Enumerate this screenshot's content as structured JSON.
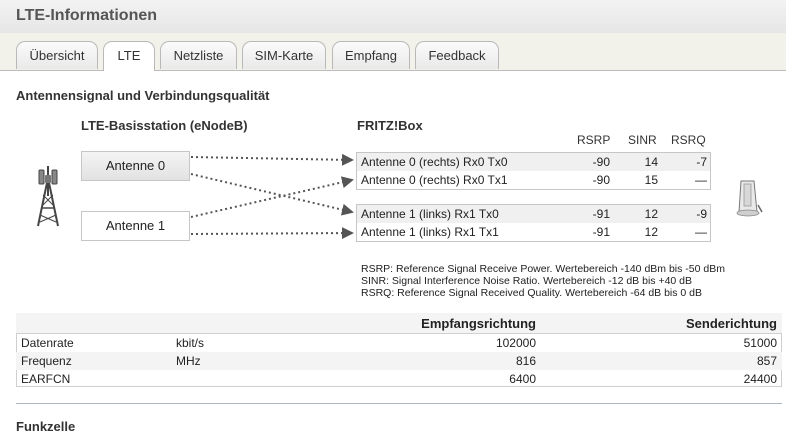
{
  "window": {
    "title": "LTE-Informationen"
  },
  "tabs": [
    {
      "label": "Übersicht",
      "active": false
    },
    {
      "label": "LTE",
      "active": true
    },
    {
      "label": "Netzliste",
      "active": false
    },
    {
      "label": "SIM-Karte",
      "active": false
    },
    {
      "label": "Empfang",
      "active": false
    },
    {
      "label": "Feedback",
      "active": false
    }
  ],
  "section": {
    "heading": "Antennensignal und Verbindungsqualität"
  },
  "basestation": {
    "heading": "LTE-Basisstation (eNodeB)",
    "antenna0": "Antenne 0",
    "antenna1": "Antenne 1"
  },
  "fritzbox": {
    "heading": "FRITZ!Box",
    "columns": [
      "RSRP",
      "SINR",
      "RSRQ"
    ],
    "rows": [
      {
        "label": "Antenne 0 (rechts) Rx0 Tx0",
        "rsrp": "-90",
        "sinr": "14",
        "rsrq": "-7"
      },
      {
        "label": "Antenne 0 (rechts) Rx0 Tx1",
        "rsrp": "-90",
        "sinr": "15",
        "rsrq": "—"
      },
      {
        "label": "Antenne 1 (links) Rx1 Tx0",
        "rsrp": "-91",
        "sinr": "12",
        "rsrq": "-9"
      },
      {
        "label": "Antenne 1 (links) Rx1 Tx1",
        "rsrp": "-91",
        "sinr": "12",
        "rsrq": "—"
      }
    ]
  },
  "legend": [
    "RSRP: Reference Signal Receive Power. Wertebereich -140 dBm bis -50 dBm",
    "SINR: Signal Interference Noise Ratio. Wertebereich -12 dB bis +40 dB",
    "RSRQ: Reference Signal Received Quality. Wertebereich -64 dB bis 0 dB"
  ],
  "stats": {
    "headers": [
      "",
      "",
      "Empfangsrichtung",
      "Senderichtung"
    ],
    "rows": [
      {
        "name": "Datenrate",
        "unit": "kbit/s",
        "rx": "102000",
        "tx": "51000"
      },
      {
        "name": "Frequenz",
        "unit": "MHz",
        "rx": "816",
        "tx": "857"
      },
      {
        "name": "EARFCN",
        "unit": "",
        "rx": "6400",
        "tx": "24400"
      }
    ]
  },
  "next_section": {
    "heading": "Funkzelle"
  },
  "icons": {
    "tower": "cell-tower-icon",
    "device": "fritzbox-device-icon"
  },
  "colors": {
    "link_dots": "#555555",
    "title_text": "#555555"
  }
}
